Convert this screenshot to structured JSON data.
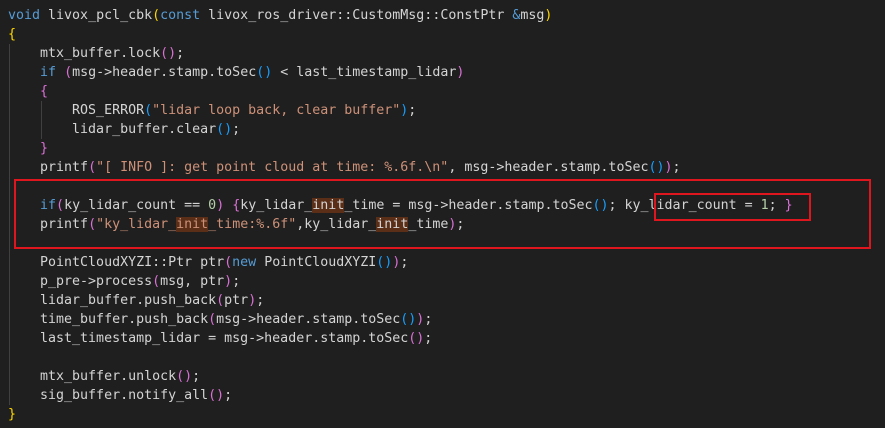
{
  "colors": {
    "background": "#1f1f1f",
    "highlight_box": "#e0161e"
  },
  "code_lines": [
    [
      [
        "void",
        "kw"
      ],
      [
        " livox_pcl_cbk",
        ""
      ],
      [
        "(",
        "b1"
      ],
      [
        "const",
        "kw"
      ],
      [
        " livox_ros_driver::CustomMsg::ConstPtr ",
        ""
      ],
      [
        "&",
        "kw"
      ],
      [
        "msg",
        ""
      ],
      [
        ")",
        "b1"
      ]
    ],
    [
      [
        "{",
        "b1"
      ]
    ],
    [
      [
        "    mtx_buffer.lock",
        ""
      ],
      [
        "(",
        "b2"
      ],
      [
        ")",
        "b2"
      ],
      [
        ";",
        ""
      ]
    ],
    [
      [
        "    ",
        ""
      ],
      [
        "if",
        "kw"
      ],
      [
        " ",
        ""
      ],
      [
        "(",
        "b2"
      ],
      [
        "msg->header.stamp.toSec",
        ""
      ],
      [
        "()",
        "b3"
      ],
      [
        " < last_timestamp_lidar",
        ""
      ],
      [
        ")",
        "b2"
      ]
    ],
    [
      [
        "    ",
        ""
      ],
      [
        "{",
        "b2"
      ]
    ],
    [
      [
        "        ROS_ERROR",
        ""
      ],
      [
        "(",
        "b3"
      ],
      [
        "\"lidar loop back, clear buffer\"",
        "str"
      ],
      [
        ")",
        "b3"
      ],
      [
        ";",
        ""
      ]
    ],
    [
      [
        "        lidar_buffer.clear",
        ""
      ],
      [
        "()",
        "b3"
      ],
      [
        ";",
        ""
      ]
    ],
    [
      [
        "    ",
        ""
      ],
      [
        "}",
        "b2"
      ]
    ],
    [
      [
        "    printf",
        ""
      ],
      [
        "(",
        "b2"
      ],
      [
        "\"[ INFO ]: get point cloud at time: %.6f.\\n\"",
        "str"
      ],
      [
        ", msg->header.stamp.toSec",
        ""
      ],
      [
        "()",
        "b3"
      ],
      [
        ")",
        "b2"
      ],
      [
        ";",
        ""
      ]
    ],
    [],
    [
      [
        "    ",
        ""
      ],
      [
        "if",
        "kw"
      ],
      [
        "(",
        "b2"
      ],
      [
        "ky_lidar_count == ",
        ""
      ],
      [
        "0",
        "num"
      ],
      [
        ")",
        "b2"
      ],
      [
        " ",
        ""
      ],
      [
        "{",
        "b2"
      ],
      [
        "ky_lidar_",
        ""
      ],
      [
        "init",
        "hl"
      ],
      [
        "_time = msg->header.stamp.toSec",
        ""
      ],
      [
        "()",
        "b3"
      ],
      [
        "; ky_lidar_count = ",
        ""
      ],
      [
        "1",
        "num"
      ],
      [
        "; ",
        ""
      ],
      [
        "}",
        "b2"
      ]
    ],
    [
      [
        "    printf",
        ""
      ],
      [
        "(",
        "b2"
      ],
      [
        "\"ky_lidar_",
        "str"
      ],
      [
        "init",
        "str hl"
      ],
      [
        "_time:%.6f\"",
        "str"
      ],
      [
        ",ky_lidar_",
        ""
      ],
      [
        "init",
        "hl"
      ],
      [
        "_time",
        ""
      ],
      [
        ")",
        "b2"
      ],
      [
        ";",
        ""
      ]
    ],
    [],
    [
      [
        "    PointCloudXYZI::Ptr ptr",
        ""
      ],
      [
        "(",
        "b2"
      ],
      [
        "new",
        "kw"
      ],
      [
        " PointCloudXYZI",
        ""
      ],
      [
        "()",
        "b3"
      ],
      [
        ")",
        "b2"
      ],
      [
        ";",
        ""
      ]
    ],
    [
      [
        "    p_pre->process",
        ""
      ],
      [
        "(",
        "b2"
      ],
      [
        "msg, ptr",
        ""
      ],
      [
        ")",
        "b2"
      ],
      [
        ";",
        ""
      ]
    ],
    [
      [
        "    lidar_buffer.push_back",
        ""
      ],
      [
        "(",
        "b2"
      ],
      [
        "ptr",
        ""
      ],
      [
        ")",
        "b2"
      ],
      [
        ";",
        ""
      ]
    ],
    [
      [
        "    time_buffer.push_back",
        ""
      ],
      [
        "(",
        "b2"
      ],
      [
        "msg->header.stamp.toSec",
        ""
      ],
      [
        "()",
        "b3"
      ],
      [
        ")",
        "b2"
      ],
      [
        ";",
        ""
      ]
    ],
    [
      [
        "    last_timestamp_lidar = msg->header.stamp.toSec",
        ""
      ],
      [
        "()",
        "b2"
      ],
      [
        ";",
        ""
      ]
    ],
    [],
    [
      [
        "    mtx_buffer.unlock",
        ""
      ],
      [
        "()",
        "b2"
      ],
      [
        ";",
        ""
      ]
    ],
    [
      [
        "    sig_buffer.notify_all",
        ""
      ],
      [
        "()",
        "b2"
      ],
      [
        ";",
        ""
      ]
    ],
    [
      [
        "}",
        "b1"
      ]
    ]
  ]
}
